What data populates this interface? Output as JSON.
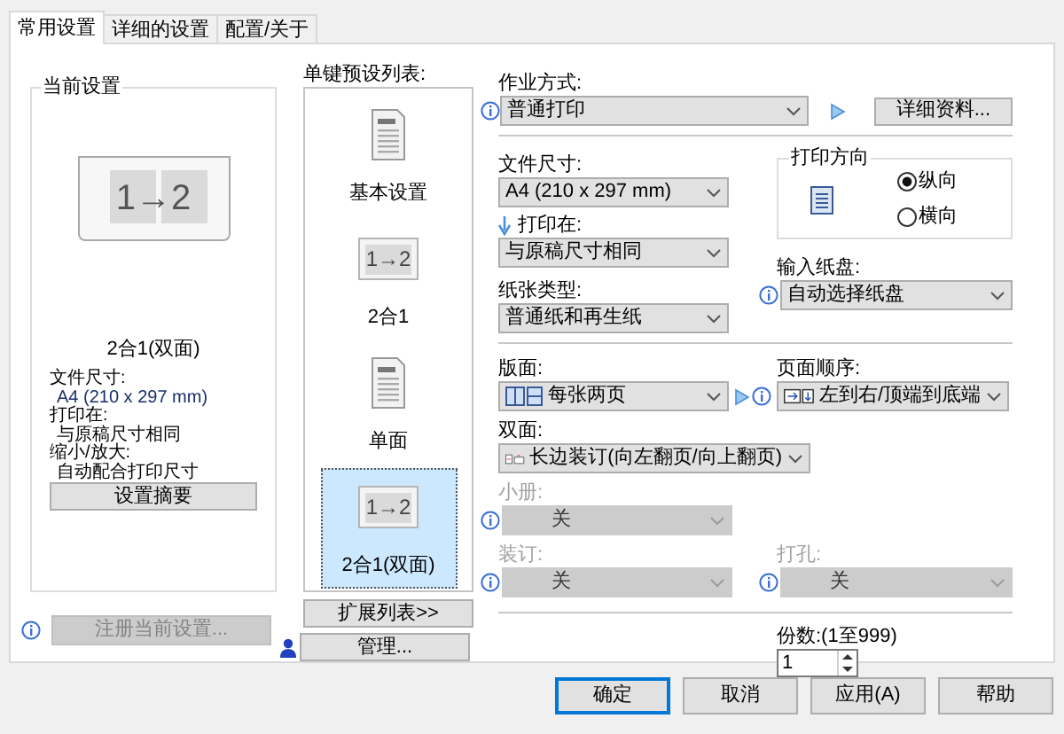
{
  "tabs": [
    {
      "label": "常用设置",
      "selected": true
    },
    {
      "label": "详细的设置",
      "selected": false
    },
    {
      "label": "配置/关于",
      "selected": false
    }
  ],
  "current_settings": {
    "title": "当前设置",
    "preview_text": "1→2",
    "caption": "2合1(双面)",
    "details": [
      {
        "label": "文件尺寸:",
        "value": "A4 (210 x 297 mm)"
      },
      {
        "label": "打印在:",
        "value": "与原稿尺寸相同"
      },
      {
        "label": "缩小/放大:",
        "value": "自动配合打印尺寸"
      }
    ],
    "summary_button": "设置摘要"
  },
  "register_button": {
    "label": "注册当前设置...",
    "disabled": true
  },
  "presets": {
    "title": "单键预设列表:",
    "items": [
      {
        "label": "基本设置",
        "kind": "document",
        "selected": false
      },
      {
        "label": "2合1",
        "kind": "two-in-one",
        "icon_text": "1→2",
        "selected": false
      },
      {
        "label": "单面",
        "kind": "document",
        "selected": false
      },
      {
        "label": "2合1(双面)",
        "kind": "two-in-one",
        "icon_text": "1→2",
        "selected": true
      }
    ],
    "expand_button": "扩展列表>>",
    "manage_button": "管理..."
  },
  "settings": {
    "job_type": {
      "label": "作业方式:",
      "value": "普通打印"
    },
    "details_button": "详细资料...",
    "document_size": {
      "label": "文件尺寸:",
      "value": "A4 (210 x 297 mm)"
    },
    "print_on": {
      "label": "打印在:",
      "value": "与原稿尺寸相同"
    },
    "orientation": {
      "title": "打印方向",
      "options": [
        {
          "label": "纵向",
          "selected": true
        },
        {
          "label": "横向",
          "selected": false
        }
      ]
    },
    "paper_type": {
      "label": "纸张类型:",
      "value": "普通纸和再生纸"
    },
    "input_tray": {
      "label": "输入纸盘:",
      "value": "自动选择纸盘"
    },
    "layout": {
      "label": "版面:",
      "value": "每张两页"
    },
    "page_order": {
      "label": "页面顺序:",
      "value": "左到右/顶端到底端"
    },
    "duplex": {
      "label": "双面:",
      "value": "长边装订(向左翻页/向上翻页)"
    },
    "booklet": {
      "label": "小册:",
      "value": "关",
      "disabled": true
    },
    "binding": {
      "label": "装订:",
      "value": "关",
      "disabled": true
    },
    "punch": {
      "label": "打孔:",
      "value": "关",
      "disabled": true
    },
    "copies": {
      "label": "份数:(1至999)",
      "value": "1"
    }
  },
  "buttons": [
    {
      "label": "确定",
      "focused": true
    },
    {
      "label": "取消",
      "focused": false
    },
    {
      "label": "应用(A)",
      "focused": false
    },
    {
      "label": "帮助",
      "focused": false
    }
  ]
}
